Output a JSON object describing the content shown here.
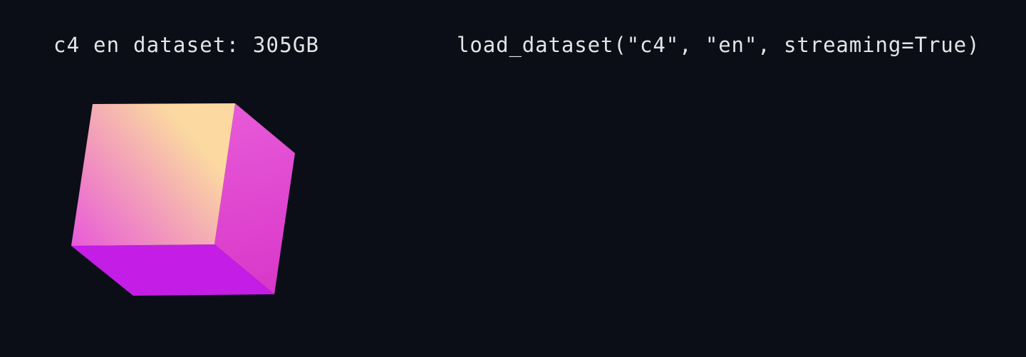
{
  "dataset_label": "c4 en dataset: 305GB",
  "code_snippet": "load_dataset(\"c4\", \"en\", streaming=True)",
  "cube": {
    "icon": "cube-icon",
    "colors": {
      "front_top": "#fbd9a0",
      "front_bottom": "#e85ad8",
      "right_top": "#e75ad8",
      "right_bottom": "#d937c9",
      "bottom": "#c41de6"
    }
  },
  "colors": {
    "background": "#0b0e17",
    "text": "#e4e4e7"
  }
}
